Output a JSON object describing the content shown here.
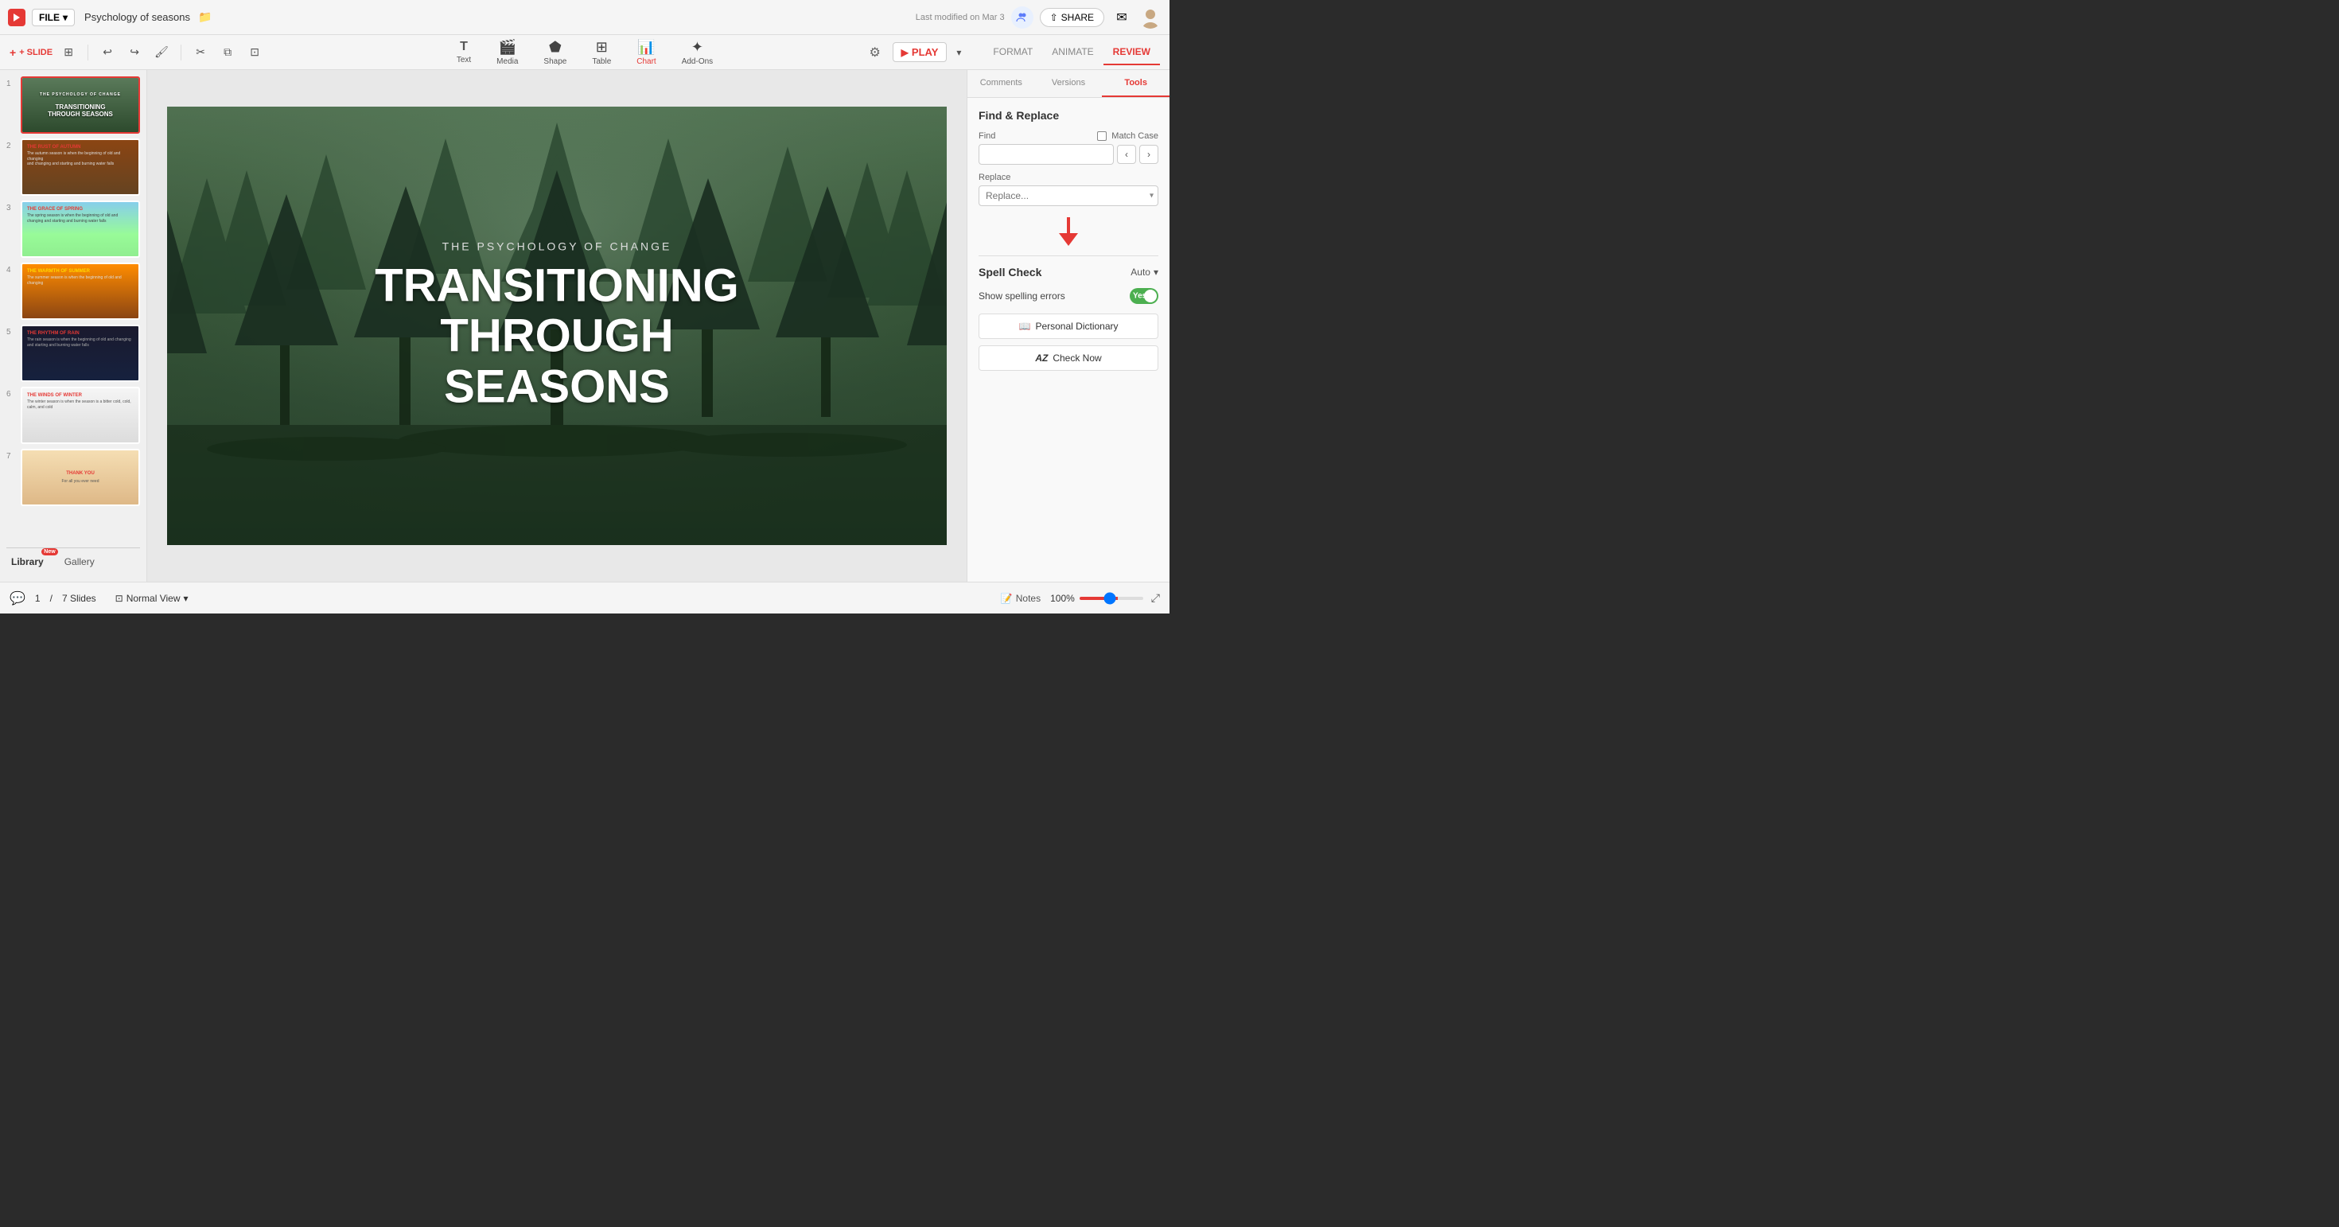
{
  "app": {
    "title": "Psychology of seasons",
    "last_modified": "Last modified on Mar 3",
    "share_label": "SHARE",
    "play_label": "PLAY",
    "file_label": "FILE"
  },
  "toolbar": {
    "slide_label": "+ SLIDE",
    "tools": [
      "Text",
      "Media",
      "Shape",
      "Table",
      "Chart",
      "Add-Ons"
    ],
    "undo_label": "undo",
    "redo_label": "redo"
  },
  "tabs": {
    "format_label": "FORMAT",
    "animate_label": "ANIMATE",
    "review_label": "REVIEW"
  },
  "panel_tabs": {
    "comments_label": "Comments",
    "versions_label": "Versions",
    "tools_label": "Tools"
  },
  "find_replace": {
    "title": "Find & Replace",
    "find_label": "Find",
    "replace_label": "Replace",
    "match_case_label": "Match Case",
    "find_placeholder": "",
    "replace_placeholder": "Replace..."
  },
  "spell_check": {
    "title": "Spell Check",
    "mode": "Auto",
    "show_errors_label": "Show spelling errors",
    "toggle_state": "Yes",
    "personal_dict_label": "Personal Dictionary",
    "check_now_label": "Check Now"
  },
  "slide": {
    "subtitle": "THE PSYCHOLOGY OF CHANGE",
    "title_line1": "TRANSITIONING THROUGH",
    "title_line2": "SEASONS"
  },
  "slides": [
    {
      "num": "1",
      "title1": "TRANSITIONING THROUGH",
      "title2": "SEASONS",
      "type": "dark-forest"
    },
    {
      "num": "2",
      "title": "THE RUST OF AUTUMN",
      "type": "rust"
    },
    {
      "num": "3",
      "title": "THE GRACE OF SPRING",
      "type": "spring"
    },
    {
      "num": "4",
      "title": "THE WARMTH OF SUMMER",
      "type": "summer"
    },
    {
      "num": "5",
      "title": "THE RHYTHM OF RAIN",
      "type": "rain"
    },
    {
      "num": "6",
      "title": "THE WINDS OF WINTER",
      "type": "winter"
    },
    {
      "num": "7",
      "title": "THANK YOU",
      "type": "thankyou"
    }
  ],
  "bottom": {
    "slide_num": "1",
    "total_slides": "7 Slides",
    "view_label": "Normal View",
    "notes_label": "Notes",
    "zoom_level": "100%",
    "library_label": "Library",
    "gallery_label": "Gallery",
    "new_badge": "New"
  },
  "icons": {
    "logo": "▶",
    "undo": "↩",
    "redo": "↪",
    "clone": "⧉",
    "scissors": "✂",
    "copy": "⧉",
    "paste": "📋",
    "grid": "⊞",
    "text": "T",
    "media": "🎬",
    "shape": "⬟",
    "table": "⊞",
    "chart": "📊",
    "addons": "✦",
    "settings": "⚙",
    "play_arrow": "▶",
    "collab": "👥",
    "notif": "✉",
    "chat": "💬",
    "notes_icon": "📝",
    "view_icon": "⊡",
    "fullscreen": "⤢",
    "personal_dict_icon": "📖",
    "check_now_icon": "AZ"
  }
}
